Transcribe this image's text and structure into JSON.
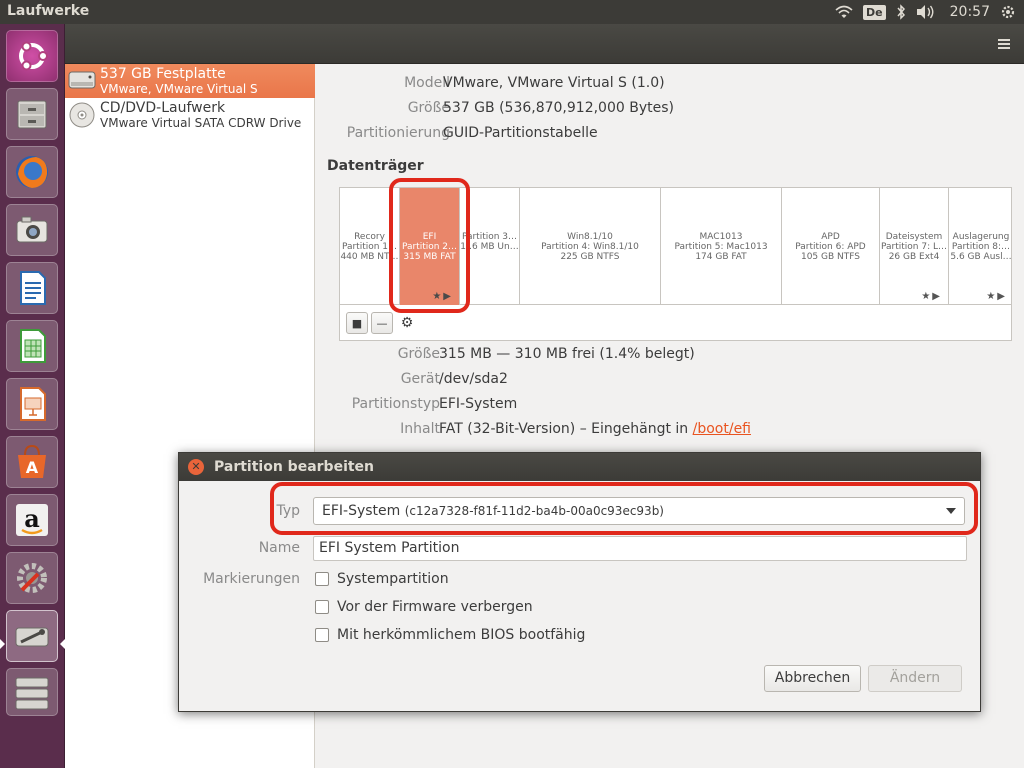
{
  "window": {
    "title": "Laufwerke"
  },
  "topbar": {
    "keyboard_layout": "De",
    "clock": "20:57",
    "icons": [
      "wifi-icon",
      "bluetooth-icon",
      "volume-icon"
    ]
  },
  "launcher": {
    "items": [
      {
        "name": "ubuntu-dash-icon",
        "color": "#e95420"
      },
      {
        "name": "files-icon",
        "color": "#8c8a85"
      },
      {
        "name": "firefox-icon",
        "color": "#ef6c1a"
      },
      {
        "name": "shotwell-icon",
        "color": "#b5b3ad"
      },
      {
        "name": "writer-icon",
        "color": "#2a6ab0"
      },
      {
        "name": "calc-icon",
        "color": "#3e9b3a"
      },
      {
        "name": "impress-icon",
        "color": "#d66a2c"
      },
      {
        "name": "software-center-icon",
        "color": "#e8672a"
      },
      {
        "name": "amazon-icon",
        "color": "#f2f1f0"
      },
      {
        "name": "system-settings-icon",
        "color": "#c2c0bb"
      },
      {
        "name": "disks-icon",
        "color": "#b7b5b0"
      },
      {
        "name": "drive-icon",
        "color": "#b7b5b0"
      }
    ]
  },
  "devices": [
    {
      "name": "537 GB Festplatte",
      "sub": "VMware, VMware Virtual S",
      "selected": true,
      "icon": "hard-disk-icon"
    },
    {
      "name": "CD/DVD-Laufwerk",
      "sub": "VMware Virtual SATA CDRW Drive",
      "selected": false,
      "icon": "optical-disc-icon"
    }
  ],
  "drive_info": {
    "model_label": "Modell",
    "model": "VMware, VMware Virtual S (1.0)",
    "size_label": "Größe",
    "size": "537 GB (536,870,912,000 Bytes)",
    "partitioning_label": "Partitionierung",
    "partitioning": "GUID-Partitionstabelle"
  },
  "volumes_title": "Datenträger",
  "volumes": [
    {
      "l1": "Recory",
      "l2": "Partition 1…",
      "l3": "440 MB NT…",
      "active": false,
      "star": false
    },
    {
      "l1": "EFI",
      "l2": "Partition 2…",
      "l3": "315 MB FAT",
      "active": true,
      "star": true
    },
    {
      "l1": "",
      "l2": "Partition 3…",
      "l3": "1‥6 MB Un…",
      "active": false,
      "star": false
    },
    {
      "l1": "Win8.1/10",
      "l2": "Partition 4: Win8.1/10",
      "l3": "225 GB NTFS",
      "active": false,
      "star": false
    },
    {
      "l1": "MAC1013",
      "l2": "Partition 5: Mac1013",
      "l3": "174 GB FAT",
      "active": false,
      "star": false
    },
    {
      "l1": "APD",
      "l2": "Partition 6: APD",
      "l3": "105 GB NTFS",
      "active": false,
      "star": false
    },
    {
      "l1": "Dateisystem",
      "l2": "Partition 7: L…",
      "l3": "26 GB Ext4",
      "active": false,
      "star": true
    },
    {
      "l1": "Auslagerung",
      "l2": "Partition 8:…",
      "l3": "5.6 GB Ausl…",
      "active": false,
      "star": true
    }
  ],
  "volume_tools": {
    "stop_symbol": "■",
    "minus_symbol": "—",
    "gear_symbol": "⚙"
  },
  "partition_info": {
    "size_label": "Größe",
    "size": "315 MB — 310 MB frei (1.4% belegt)",
    "device_label": "Gerät",
    "device": "/dev/sda2",
    "type_label": "Partitionstyp",
    "type": "EFI-System",
    "content_label": "Inhalt",
    "content": "FAT (32-Bit-Version) – Eingehängt in ",
    "mount": "/boot/efi"
  },
  "dialog": {
    "title": "Partition bearbeiten",
    "type_label": "Typ",
    "type_value": "EFI-System",
    "type_uuid": "(c12a7328-f81f-11d2-ba4b-00a0c93ec93b)",
    "name_label": "Name",
    "name_value": "EFI System Partition",
    "flags_label": "Markierungen",
    "flags": [
      "Systempartition",
      "Vor der Firmware verbergen",
      "Mit herkömmlichem BIOS bootfähig"
    ],
    "cancel_label": "Abbrechen",
    "apply_label": "Ändern"
  },
  "highlight_color": "#e0281b",
  "accent_color": "#e9764a"
}
